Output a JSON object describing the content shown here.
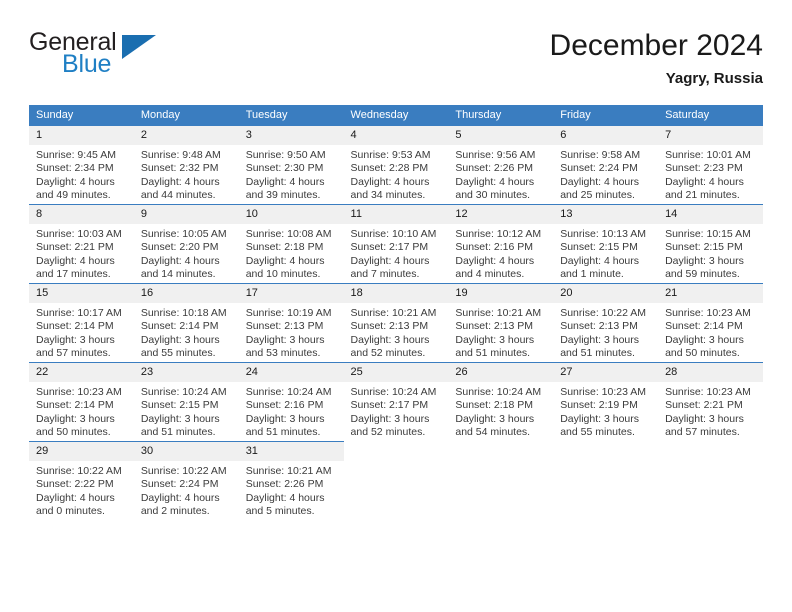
{
  "brand": {
    "name_top": "General",
    "name_bottom": "Blue",
    "triangle_color": "#1a6eb0",
    "blue_text_color": "#1f7fc4"
  },
  "header": {
    "title": "December 2024",
    "subtitle": "Yagry, Russia"
  },
  "colors": {
    "header_row_bg": "#3a7dc0",
    "daynum_bg": "#f0f0f0",
    "row_divider": "#3a7dc0",
    "text": "#3b3b3b"
  },
  "weekdays": [
    "Sunday",
    "Monday",
    "Tuesday",
    "Wednesday",
    "Thursday",
    "Friday",
    "Saturday"
  ],
  "weeks": [
    [
      {
        "day": "1",
        "sunrise": "Sunrise: 9:45 AM",
        "sunset": "Sunset: 2:34 PM",
        "daylight1": "Daylight: 4 hours",
        "daylight2": "and 49 minutes."
      },
      {
        "day": "2",
        "sunrise": "Sunrise: 9:48 AM",
        "sunset": "Sunset: 2:32 PM",
        "daylight1": "Daylight: 4 hours",
        "daylight2": "and 44 minutes."
      },
      {
        "day": "3",
        "sunrise": "Sunrise: 9:50 AM",
        "sunset": "Sunset: 2:30 PM",
        "daylight1": "Daylight: 4 hours",
        "daylight2": "and 39 minutes."
      },
      {
        "day": "4",
        "sunrise": "Sunrise: 9:53 AM",
        "sunset": "Sunset: 2:28 PM",
        "daylight1": "Daylight: 4 hours",
        "daylight2": "and 34 minutes."
      },
      {
        "day": "5",
        "sunrise": "Sunrise: 9:56 AM",
        "sunset": "Sunset: 2:26 PM",
        "daylight1": "Daylight: 4 hours",
        "daylight2": "and 30 minutes."
      },
      {
        "day": "6",
        "sunrise": "Sunrise: 9:58 AM",
        "sunset": "Sunset: 2:24 PM",
        "daylight1": "Daylight: 4 hours",
        "daylight2": "and 25 minutes."
      },
      {
        "day": "7",
        "sunrise": "Sunrise: 10:01 AM",
        "sunset": "Sunset: 2:23 PM",
        "daylight1": "Daylight: 4 hours",
        "daylight2": "and 21 minutes."
      }
    ],
    [
      {
        "day": "8",
        "sunrise": "Sunrise: 10:03 AM",
        "sunset": "Sunset: 2:21 PM",
        "daylight1": "Daylight: 4 hours",
        "daylight2": "and 17 minutes."
      },
      {
        "day": "9",
        "sunrise": "Sunrise: 10:05 AM",
        "sunset": "Sunset: 2:20 PM",
        "daylight1": "Daylight: 4 hours",
        "daylight2": "and 14 minutes."
      },
      {
        "day": "10",
        "sunrise": "Sunrise: 10:08 AM",
        "sunset": "Sunset: 2:18 PM",
        "daylight1": "Daylight: 4 hours",
        "daylight2": "and 10 minutes."
      },
      {
        "day": "11",
        "sunrise": "Sunrise: 10:10 AM",
        "sunset": "Sunset: 2:17 PM",
        "daylight1": "Daylight: 4 hours",
        "daylight2": "and 7 minutes."
      },
      {
        "day": "12",
        "sunrise": "Sunrise: 10:12 AM",
        "sunset": "Sunset: 2:16 PM",
        "daylight1": "Daylight: 4 hours",
        "daylight2": "and 4 minutes."
      },
      {
        "day": "13",
        "sunrise": "Sunrise: 10:13 AM",
        "sunset": "Sunset: 2:15 PM",
        "daylight1": "Daylight: 4 hours",
        "daylight2": "and 1 minute."
      },
      {
        "day": "14",
        "sunrise": "Sunrise: 10:15 AM",
        "sunset": "Sunset: 2:15 PM",
        "daylight1": "Daylight: 3 hours",
        "daylight2": "and 59 minutes."
      }
    ],
    [
      {
        "day": "15",
        "sunrise": "Sunrise: 10:17 AM",
        "sunset": "Sunset: 2:14 PM",
        "daylight1": "Daylight: 3 hours",
        "daylight2": "and 57 minutes."
      },
      {
        "day": "16",
        "sunrise": "Sunrise: 10:18 AM",
        "sunset": "Sunset: 2:14 PM",
        "daylight1": "Daylight: 3 hours",
        "daylight2": "and 55 minutes."
      },
      {
        "day": "17",
        "sunrise": "Sunrise: 10:19 AM",
        "sunset": "Sunset: 2:13 PM",
        "daylight1": "Daylight: 3 hours",
        "daylight2": "and 53 minutes."
      },
      {
        "day": "18",
        "sunrise": "Sunrise: 10:21 AM",
        "sunset": "Sunset: 2:13 PM",
        "daylight1": "Daylight: 3 hours",
        "daylight2": "and 52 minutes."
      },
      {
        "day": "19",
        "sunrise": "Sunrise: 10:21 AM",
        "sunset": "Sunset: 2:13 PM",
        "daylight1": "Daylight: 3 hours",
        "daylight2": "and 51 minutes."
      },
      {
        "day": "20",
        "sunrise": "Sunrise: 10:22 AM",
        "sunset": "Sunset: 2:13 PM",
        "daylight1": "Daylight: 3 hours",
        "daylight2": "and 51 minutes."
      },
      {
        "day": "21",
        "sunrise": "Sunrise: 10:23 AM",
        "sunset": "Sunset: 2:14 PM",
        "daylight1": "Daylight: 3 hours",
        "daylight2": "and 50 minutes."
      }
    ],
    [
      {
        "day": "22",
        "sunrise": "Sunrise: 10:23 AM",
        "sunset": "Sunset: 2:14 PM",
        "daylight1": "Daylight: 3 hours",
        "daylight2": "and 50 minutes."
      },
      {
        "day": "23",
        "sunrise": "Sunrise: 10:24 AM",
        "sunset": "Sunset: 2:15 PM",
        "daylight1": "Daylight: 3 hours",
        "daylight2": "and 51 minutes."
      },
      {
        "day": "24",
        "sunrise": "Sunrise: 10:24 AM",
        "sunset": "Sunset: 2:16 PM",
        "daylight1": "Daylight: 3 hours",
        "daylight2": "and 51 minutes."
      },
      {
        "day": "25",
        "sunrise": "Sunrise: 10:24 AM",
        "sunset": "Sunset: 2:17 PM",
        "daylight1": "Daylight: 3 hours",
        "daylight2": "and 52 minutes."
      },
      {
        "day": "26",
        "sunrise": "Sunrise: 10:24 AM",
        "sunset": "Sunset: 2:18 PM",
        "daylight1": "Daylight: 3 hours",
        "daylight2": "and 54 minutes."
      },
      {
        "day": "27",
        "sunrise": "Sunrise: 10:23 AM",
        "sunset": "Sunset: 2:19 PM",
        "daylight1": "Daylight: 3 hours",
        "daylight2": "and 55 minutes."
      },
      {
        "day": "28",
        "sunrise": "Sunrise: 10:23 AM",
        "sunset": "Sunset: 2:21 PM",
        "daylight1": "Daylight: 3 hours",
        "daylight2": "and 57 minutes."
      }
    ],
    [
      {
        "day": "29",
        "sunrise": "Sunrise: 10:22 AM",
        "sunset": "Sunset: 2:22 PM",
        "daylight1": "Daylight: 4 hours",
        "daylight2": "and 0 minutes."
      },
      {
        "day": "30",
        "sunrise": "Sunrise: 10:22 AM",
        "sunset": "Sunset: 2:24 PM",
        "daylight1": "Daylight: 4 hours",
        "daylight2": "and 2 minutes."
      },
      {
        "day": "31",
        "sunrise": "Sunrise: 10:21 AM",
        "sunset": "Sunset: 2:26 PM",
        "daylight1": "Daylight: 4 hours",
        "daylight2": "and 5 minutes."
      },
      {
        "day": "",
        "sunrise": "",
        "sunset": "",
        "daylight1": "",
        "daylight2": ""
      },
      {
        "day": "",
        "sunrise": "",
        "sunset": "",
        "daylight1": "",
        "daylight2": ""
      },
      {
        "day": "",
        "sunrise": "",
        "sunset": "",
        "daylight1": "",
        "daylight2": ""
      },
      {
        "day": "",
        "sunrise": "",
        "sunset": "",
        "daylight1": "",
        "daylight2": ""
      }
    ]
  ]
}
